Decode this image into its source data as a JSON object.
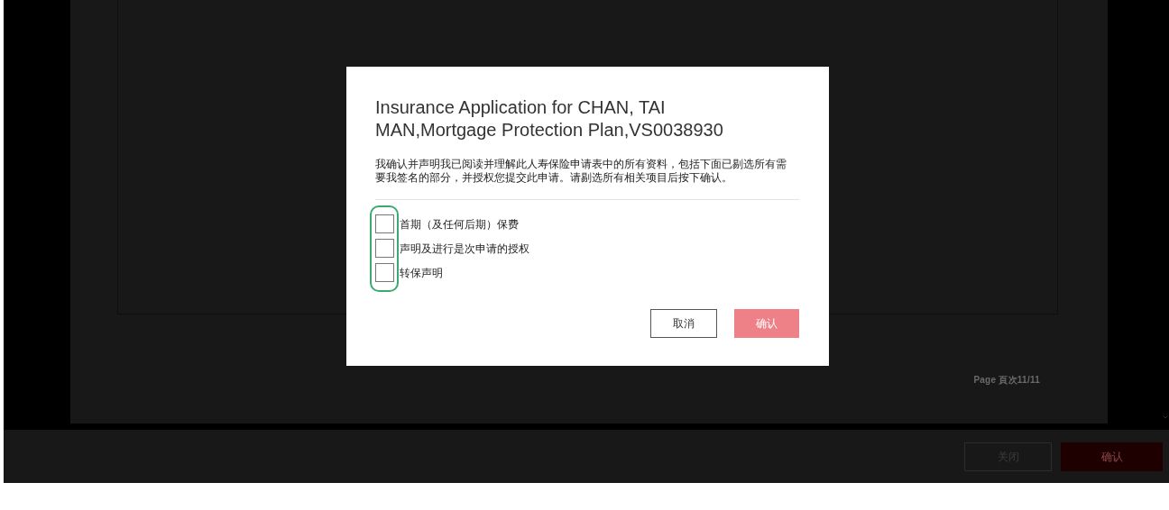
{
  "background": {
    "page_label": "Page 頁次11/11",
    "buttons": [
      {
        "label": "关闭",
        "kind": "secondary"
      },
      {
        "label": "确认",
        "kind": "primary"
      }
    ]
  },
  "dialog": {
    "title": "Insurance Application for CHAN, TAI MAN,Mortgage Protection Plan,VS0038930",
    "message": "我确认并声明我已阅读并理解此人寿保险申请表中的所有资料，包括下面已剔选所有需要我签名的部分，并授权您提交此申请。请剔选所有相关项目后按下确认。",
    "highlighted": true,
    "items": [
      {
        "label": "首期（及任何后期）保费",
        "checked": false
      },
      {
        "label": "声明及进行是次申请的授权",
        "checked": false
      },
      {
        "label": "转保声明",
        "checked": false
      }
    ],
    "buttons": [
      {
        "label": "取消",
        "kind": "secondary"
      },
      {
        "label": "确认",
        "kind": "primary",
        "disabled": true
      }
    ]
  }
}
